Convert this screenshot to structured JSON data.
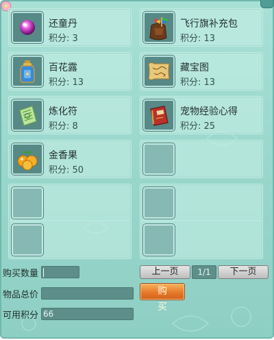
{
  "items": [
    {
      "name": "还童丹",
      "points": "积分: 3",
      "icon": "pink-pearl-icon"
    },
    {
      "name": "飞行旗补充包",
      "points": "积分: 13",
      "icon": "flag-pack-icon"
    },
    {
      "name": "百花露",
      "points": "积分: 13",
      "icon": "perfume-bottle-icon"
    },
    {
      "name": "藏宝图",
      "points": "积分: 13",
      "icon": "treasure-map-icon"
    },
    {
      "name": "炼化符",
      "points": "积分: 8",
      "icon": "talisman-icon"
    },
    {
      "name": "宠物经验心得",
      "points": "积分: 25",
      "icon": "pet-book-icon"
    },
    {
      "name": "金香果",
      "points": "积分: 50",
      "icon": "golden-fruit-icon"
    }
  ],
  "empty_slots": 5,
  "form": {
    "quantity_label": "购买数量",
    "quantity_value": "",
    "total_label": "物品总价",
    "total_value": "",
    "available_label": "可用积分",
    "available_value": "66"
  },
  "pagination": {
    "prev_label": "上一页",
    "page_indicator": "1/1",
    "next_label": "下一页"
  },
  "buy_label": "购 买",
  "colors": {
    "panel_bg": "#98d6cb",
    "field_bg": "#5d8e8a",
    "buy_button": "#e67a2a"
  }
}
